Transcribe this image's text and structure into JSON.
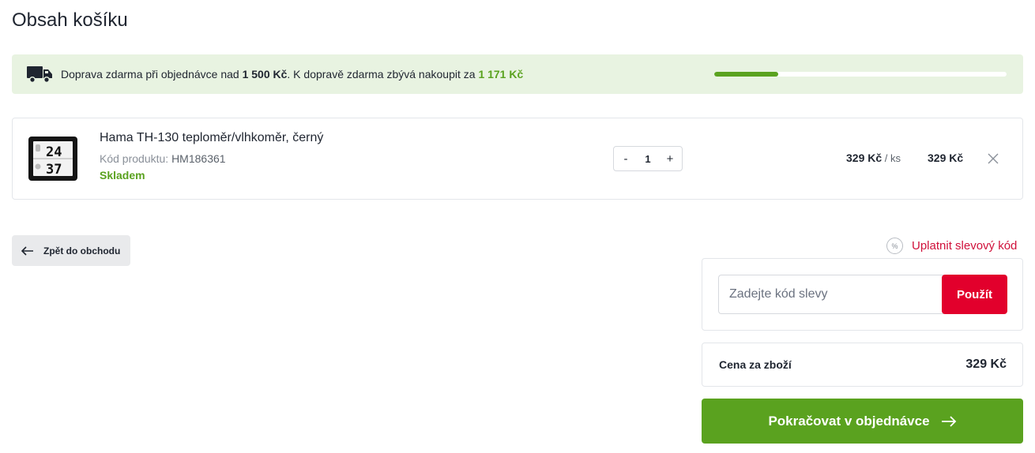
{
  "page": {
    "title": "Obsah košíku"
  },
  "shipping": {
    "text_prefix": "Doprava zdarma při objednávce nad ",
    "threshold": "1 500 Kč",
    "text_middle": ". K dopravě zdarma zbývá nakoupit za ",
    "remaining": "1 171 Kč",
    "progress_fraction": 0.22,
    "icon": "truck-icon"
  },
  "cart": {
    "items": [
      {
        "name": "Hama TH-130 teploměr/vlhkoměr, černý",
        "code_label": "Kód produktu: ",
        "code": "HM186361",
        "stock": "Skladem",
        "qty_minus": "-",
        "quantity": "1",
        "qty_plus": "+",
        "unit_price": "329 Kč",
        "unit_suffix": " / ks",
        "total_price": "329 Kč",
        "thumb_reading_top": "24",
        "thumb_reading_bottom": "37"
      }
    ]
  },
  "actions": {
    "back_label": "Zpět do obchodu",
    "discount_link": "Uplatnit slevový kód",
    "discount_icon_glyph": "%",
    "coupon_placeholder": "Zadejte kód slevy",
    "coupon_button": "Použít",
    "continue_label": "Pokračovat v objednávce"
  },
  "summary": {
    "label": "Cena za zboží",
    "value": "329 Kč"
  },
  "colors": {
    "brand_green": "#5aa21f",
    "accent_red": "#e2002c",
    "link_red": "#d0103a",
    "shipping_bg": "#e8f3e1"
  }
}
